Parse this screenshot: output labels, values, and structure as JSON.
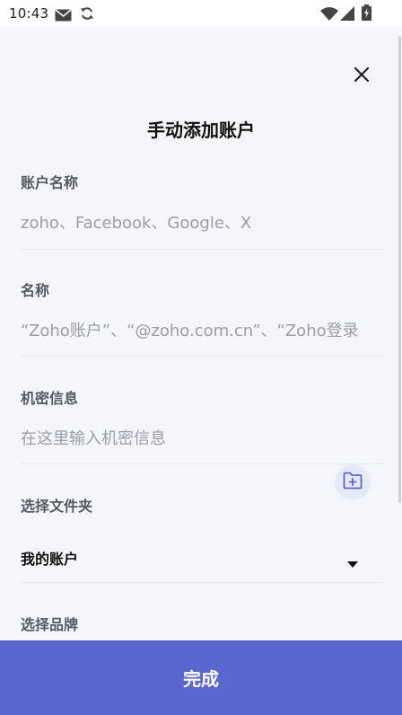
{
  "status_bar": {
    "time": "10:43",
    "icons": [
      "mail-icon",
      "sync-icon",
      "wifi-icon",
      "cellular-icon",
      "battery-icon"
    ]
  },
  "dialog": {
    "title": "手动添加账户",
    "close_icon": "close-icon"
  },
  "fields": {
    "account_name": {
      "label": "账户名称",
      "placeholder": "zoho、Facebook、Google、X"
    },
    "name": {
      "label": "名称",
      "placeholder": "“Zoho账户”、“@zoho.com.cn”、“Zoho登录"
    },
    "secret": {
      "label": "机密信息",
      "placeholder": "在这里输入机密信息"
    },
    "folder": {
      "label": "选择文件夹",
      "value": "我的账户",
      "add_folder_icon": "add-folder-icon",
      "dropdown_icon": "caret-down-icon"
    },
    "brand": {
      "label": "选择品牌"
    }
  },
  "footer": {
    "done_label": "完成"
  },
  "colors": {
    "accent": "#5b67d0",
    "background": "#f5f6fa",
    "label": "#555a66",
    "placeholder": "#9a9ea8"
  }
}
